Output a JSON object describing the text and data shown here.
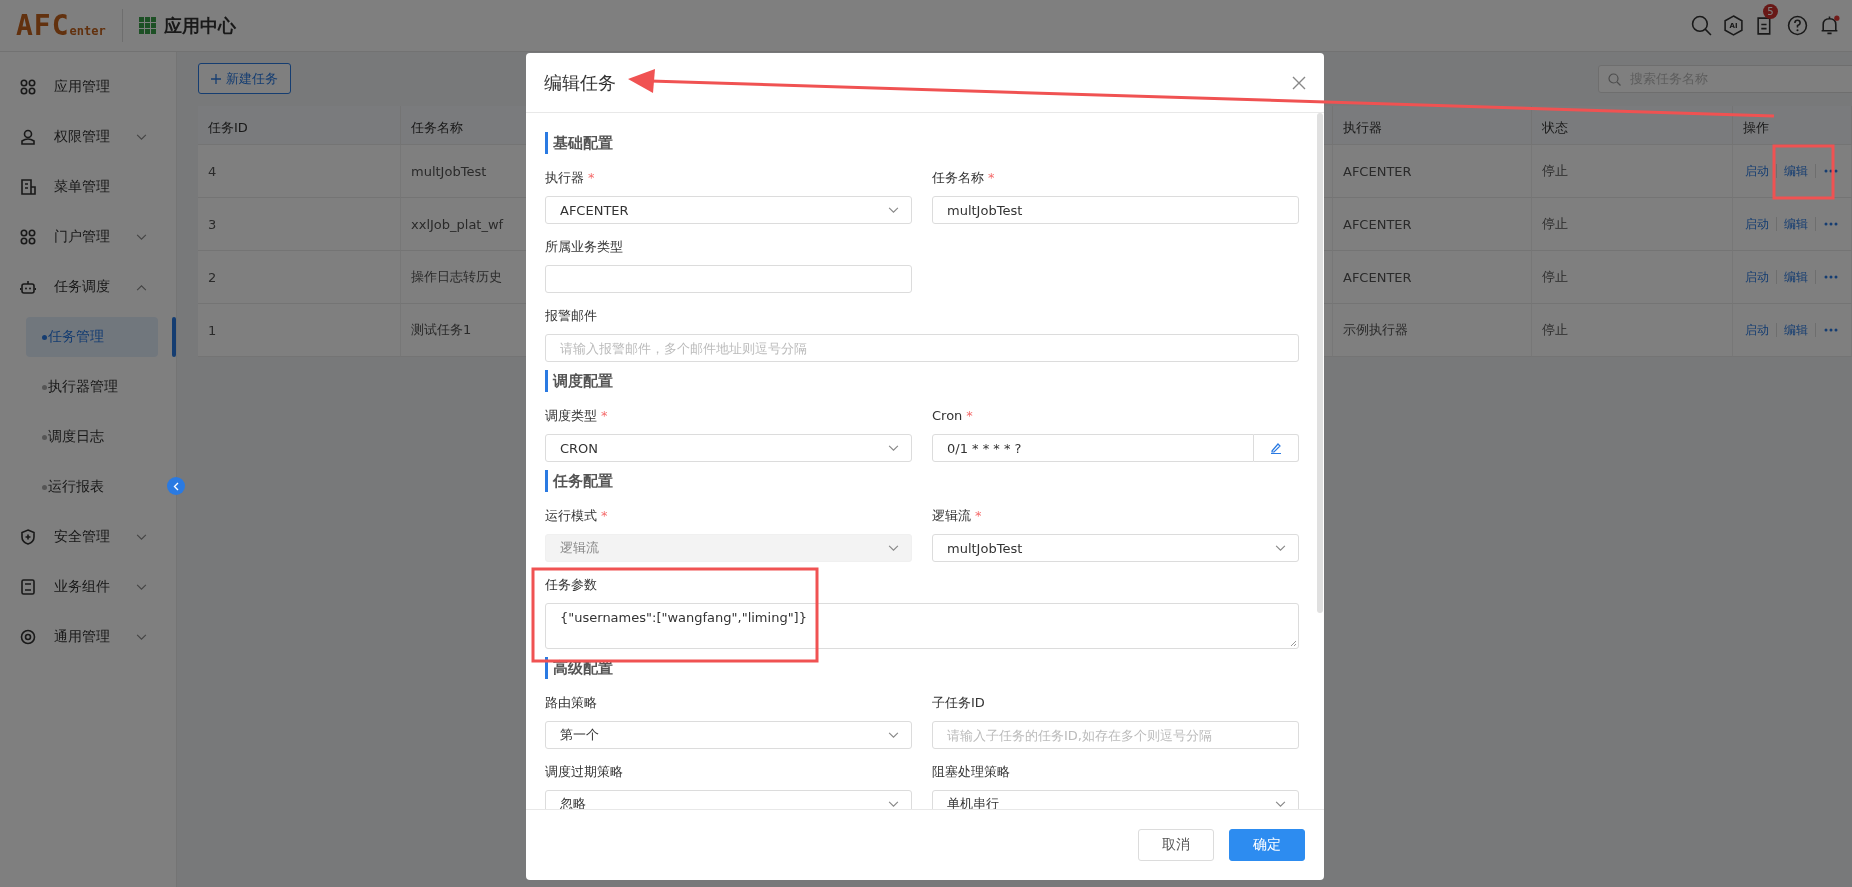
{
  "header": {
    "logo": {
      "main": "AFC",
      "sub": "enter"
    },
    "title": "应用中心",
    "ai_label": "AI",
    "badge": "5"
  },
  "sidebar": {
    "items": [
      {
        "label": "应用管理",
        "kind": "apps"
      },
      {
        "label": "权限管理",
        "kind": "user",
        "expanded": false
      },
      {
        "label": "菜单管理",
        "kind": "menu"
      },
      {
        "label": "门户管理",
        "kind": "apps",
        "expanded": false
      },
      {
        "label": "任务调度",
        "kind": "robot",
        "expanded": true,
        "children": [
          {
            "label": "任务管理",
            "selected": true
          },
          {
            "label": "执行器管理",
            "selected": false
          },
          {
            "label": "调度日志",
            "selected": false
          },
          {
            "label": "运行报表",
            "selected": false
          }
        ]
      },
      {
        "label": "安全管理",
        "kind": "shield",
        "expanded": false
      },
      {
        "label": "业务组件",
        "kind": "box",
        "expanded": false
      },
      {
        "label": "通用管理",
        "kind": "ring",
        "expanded": false
      }
    ]
  },
  "toolbar": {
    "new_button": "新建任务",
    "search": {
      "placeholder": "搜索任务名称"
    }
  },
  "table": {
    "columns": [
      "任务ID",
      "任务名称",
      "执行器",
      "状态",
      "操作"
    ],
    "rows": [
      {
        "id": "4",
        "name": "multJobTest",
        "executor": "AFCENTER",
        "status": "停止",
        "actions": [
          "启动",
          "编辑"
        ]
      },
      {
        "id": "3",
        "name": "xxlJob_plat_wf",
        "executor": "AFCENTER",
        "status": "停止",
        "actions": [
          "启动",
          "编辑"
        ]
      },
      {
        "id": "2",
        "name": "操作日志转历史",
        "executor": "AFCENTER",
        "status": "停止",
        "actions": [
          "启动",
          "编辑"
        ]
      },
      {
        "id": "1",
        "name": "测试任务1",
        "executor": "示例执行器",
        "status": "停止",
        "actions": [
          "启动",
          "编辑"
        ]
      }
    ]
  },
  "modal": {
    "title": "编辑任务",
    "required_mark": "*",
    "sections": [
      {
        "title": "基础配置",
        "fields": [
          {
            "label": "执行器",
            "required": true,
            "kind": "select",
            "value": "AFCENTER"
          },
          {
            "label": "任务名称",
            "required": true,
            "kind": "input",
            "value": "multJobTest"
          },
          {
            "label": "所属业务类型",
            "kind": "input"
          },
          {
            "kind": "blank"
          },
          {
            "label": "报警邮件",
            "kind": "wide_input",
            "placeholder": "请输入报警邮件，多个邮件地址则逗号分隔"
          }
        ]
      },
      {
        "title": "调度配置",
        "fields": [
          {
            "label": "调度类型",
            "required": true,
            "kind": "select",
            "value": "CRON"
          },
          {
            "label": "Cron",
            "required": true,
            "kind": "cron",
            "value": "0/1 * * * * ?"
          }
        ]
      },
      {
        "title": "任务配置",
        "fields": [
          {
            "label": "运行模式",
            "required": true,
            "kind": "select",
            "disabled": true,
            "value": "逻辑流"
          },
          {
            "label": "逻辑流",
            "required": true,
            "kind": "select",
            "value": "multJobTest"
          },
          {
            "label": "任务参数",
            "kind": "textarea",
            "value": "{\"usernames\":[\"wangfang\",\"liming\"]}"
          }
        ]
      },
      {
        "title": "高级配置",
        "fields": [
          {
            "label": "路由策略",
            "kind": "select",
            "value": "第一个"
          },
          {
            "label": "子任务ID",
            "kind": "input",
            "placeholder": "请输入子任务的任务ID,如存在多个则逗号分隔"
          },
          {
            "label": "调度过期策略",
            "kind": "select",
            "value": "忽略"
          },
          {
            "label": "阻塞处理策略",
            "kind": "select",
            "value": "单机串行"
          }
        ]
      }
    ],
    "buttons": [
      {
        "label": "取消",
        "kind": "default"
      },
      {
        "label": "确定",
        "kind": "primary"
      }
    ]
  }
}
